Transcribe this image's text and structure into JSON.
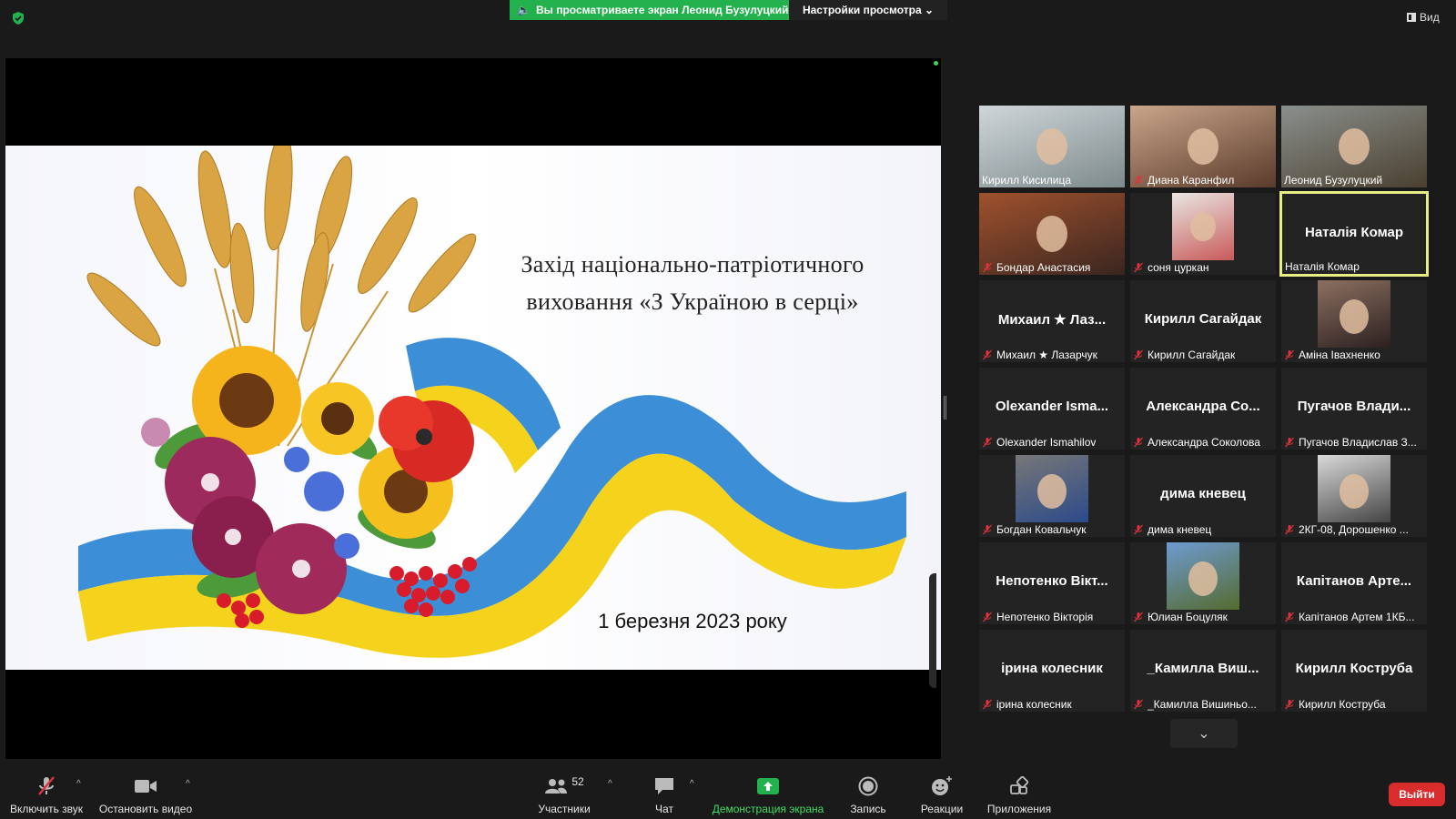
{
  "topbar": {
    "share_banner": "Вы просматриваете экран Леонид Бузулуцкий",
    "view_options": "Настройки просмотра ⌄",
    "view_button": "Вид"
  },
  "slide": {
    "title_line1": "Захід національно-патріотичного",
    "title_line2": "виховання «З Україною в серці»",
    "date": "1 березня 2023 року"
  },
  "gallery": {
    "tiles": [
      {
        "name": "Кирилл Кисилица",
        "big": "",
        "muted": false,
        "video": true
      },
      {
        "name": "Диана Каранфил",
        "big": "",
        "muted": true,
        "video": true
      },
      {
        "name": "Леонид Бузулуцкий",
        "big": "",
        "muted": false,
        "video": true
      },
      {
        "name": "Бондар Анастасия",
        "big": "",
        "muted": true,
        "video": true
      },
      {
        "name": "соня цуркан",
        "big": "",
        "muted": true,
        "video": true
      },
      {
        "name": "Наталія Комар",
        "big": "Наталія Комар",
        "muted": false,
        "video": false
      },
      {
        "name": "Михаил ★ Лазарчук",
        "big": "Михаил ★ Лаз...",
        "muted": true,
        "video": false
      },
      {
        "name": "Кирилл Сагайдак",
        "big": "Кирилл Сагайдак",
        "muted": true,
        "video": false
      },
      {
        "name": "Аміна Івахненко",
        "big": "",
        "muted": true,
        "video": true
      },
      {
        "name": "Olexander Ismahilov",
        "big": "Olexander Isma...",
        "muted": true,
        "video": false
      },
      {
        "name": "Александра Соколова",
        "big": "Александра Со...",
        "muted": true,
        "video": false
      },
      {
        "name": "Пугачов Владислав З...",
        "big": "Пугачов Влади...",
        "muted": true,
        "video": false
      },
      {
        "name": "Богдан Ковальчук",
        "big": "",
        "muted": true,
        "video": true
      },
      {
        "name": "дима кневец",
        "big": "дима кневец",
        "muted": true,
        "video": false
      },
      {
        "name": "2КГ-08, Дорошенко ...",
        "big": "",
        "muted": true,
        "video": true
      },
      {
        "name": "Непотенко Вікторія",
        "big": "Непотенко Вікт...",
        "muted": true,
        "video": false
      },
      {
        "name": "Юлиан Боцуляк",
        "big": "",
        "muted": true,
        "video": true
      },
      {
        "name": "Капітанов Артем 1КБ...",
        "big": "Капітанов Арте...",
        "muted": true,
        "video": false
      },
      {
        "name": "ірина колесник",
        "big": "ірина колесник",
        "muted": true,
        "video": false
      },
      {
        "name": "_Камилла Вишиньо...",
        "big": "_Камилла Виш...",
        "muted": true,
        "video": false
      },
      {
        "name": "Кирилл Коструба",
        "big": "Кирилл Коструба",
        "muted": true,
        "video": false
      }
    ]
  },
  "toolbar": {
    "unmute": "Включить звук",
    "stop_video": "Остановить видео",
    "participants": "Участники",
    "participants_count": "52",
    "chat": "Чат",
    "share_screen": "Демонстрация экрана",
    "record": "Запись",
    "reactions": "Реакции",
    "apps": "Приложения",
    "leave": "Выйти"
  },
  "colors": {
    "accent_green": "#22b14c",
    "active_speaker_border": "#e7ee86",
    "leave_red": "#d92d2d",
    "muted_red": "#e0323c"
  }
}
